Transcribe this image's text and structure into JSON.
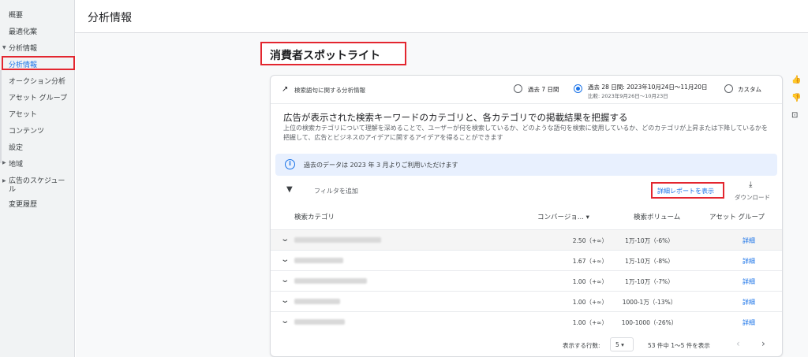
{
  "sidebar": {
    "items": [
      {
        "label": "概要"
      },
      {
        "label": "最適化案"
      },
      {
        "label": "分析情報"
      },
      {
        "label": "分析情報"
      },
      {
        "label": "オークション分析"
      },
      {
        "label": "アセット グループ"
      },
      {
        "label": "アセット"
      },
      {
        "label": "コンテンツ"
      },
      {
        "label": "設定"
      },
      {
        "label": "地域"
      },
      {
        "label": "広告のスケジュー"
      },
      {
        "label": "ル"
      },
      {
        "label": "変更履歴"
      }
    ]
  },
  "header": {
    "title": "分析情報"
  },
  "section": {
    "title": "消費者スポットライト"
  },
  "card": {
    "head_label": "検索語句に関する分析情報",
    "ranges": [
      {
        "label": "過去 7 日間",
        "selected": false
      },
      {
        "label": "過去 28 日間: 2023年10月24日～11月20日",
        "sub": "比較: 2023年9月26日～10月23日",
        "selected": true
      },
      {
        "label": "カスタム",
        "selected": false
      }
    ],
    "heading": "広告が表示された検索キーワードのカテゴリと、各カテゴリでの掲載結果を把握する",
    "description": "上位の検索カテゴリについて理解を深めることで、ユーザーが何を検索しているか、どのような語句を検索に使用しているか、どのカテゴリが上昇または下降しているかを把握して、広告とビジネスのアイデアに関するアイデアを得ることができます",
    "info": "過去のデータは 2023 年 3 月よりご利用いただけます",
    "filter_label": "フィルタを追加",
    "report_link": "詳細レポートを表示",
    "download_label": "ダウンロード",
    "columns": {
      "category": "検索カテゴリ",
      "conversion": "コンバージョ... ▾",
      "volume": "検索ボリューム",
      "asset_group": "アセット グループ"
    },
    "rows": [
      {
        "conv": "2.50（+∞）",
        "vol": "1万-10万（-6%）",
        "detail": "詳細"
      },
      {
        "conv": "1.67（+∞）",
        "vol": "1万-10万（-8%）",
        "detail": "詳細"
      },
      {
        "conv": "1.00（+∞）",
        "vol": "1万-10万（-7%）",
        "detail": "詳細"
      },
      {
        "conv": "1.00（+∞）",
        "vol": "1000-1万（-13%）",
        "detail": "詳細"
      },
      {
        "conv": "1.00（+∞）",
        "vol": "100-1000（-26%）",
        "detail": "詳細"
      }
    ],
    "footer": {
      "rows_label": "表示する行数:",
      "rows_value": "5 ▾",
      "range_text": "53 件中 1～5 件を表示"
    }
  },
  "colors": {
    "accent": "#1a73e8",
    "highlight": "#e3262f"
  }
}
